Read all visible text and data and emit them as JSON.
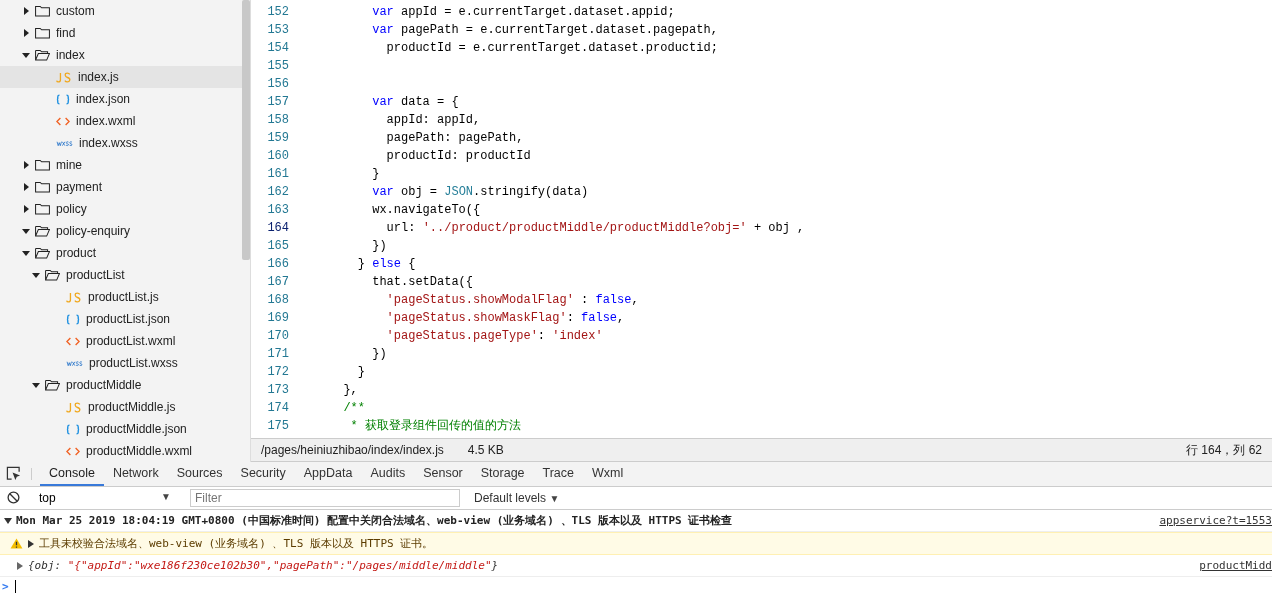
{
  "file_tree": [
    {
      "label": "custom",
      "kind": "folder",
      "expanded": false
    },
    {
      "label": "find",
      "kind": "folder",
      "expanded": false
    },
    {
      "label": "index",
      "kind": "folder",
      "expanded": true,
      "children": [
        {
          "label": "index.js",
          "kind": "js",
          "selected": true
        },
        {
          "label": "index.json",
          "kind": "json",
          "selected": false
        },
        {
          "label": "index.wxml",
          "kind": "wxml",
          "selected": false
        },
        {
          "label": "index.wxss",
          "kind": "wxss",
          "selected": false
        }
      ]
    },
    {
      "label": "mine",
      "kind": "folder",
      "expanded": false
    },
    {
      "label": "payment",
      "kind": "folder",
      "expanded": false
    },
    {
      "label": "policy",
      "kind": "folder",
      "expanded": false
    },
    {
      "label": "policy-enquiry",
      "kind": "folder",
      "expanded": true
    },
    {
      "label": "product",
      "kind": "folder",
      "expanded": true,
      "children": [
        {
          "label": "productList",
          "kind": "folder",
          "expanded": true,
          "children": [
            {
              "label": "productList.js",
              "kind": "js",
              "selected": false
            },
            {
              "label": "productList.json",
              "kind": "json",
              "selected": false
            },
            {
              "label": "productList.wxml",
              "kind": "wxml",
              "selected": false
            },
            {
              "label": "productList.wxss",
              "kind": "wxss",
              "selected": false
            }
          ]
        },
        {
          "label": "productMiddle",
          "kind": "folder",
          "expanded": true,
          "children": [
            {
              "label": "productMiddle.js",
              "kind": "js",
              "selected": false
            },
            {
              "label": "productMiddle.json",
              "kind": "json",
              "selected": false
            },
            {
              "label": "productMiddle.wxml",
              "kind": "wxml",
              "selected": false
            }
          ]
        }
      ]
    }
  ],
  "editor": {
    "lines": [
      {
        "number": "152",
        "current": false,
        "tokens": [
          {
            "kind": "keyword",
            "text": "      var"
          },
          {
            "kind": "plain",
            "text": " appId = e.currentTarget.dataset.appid;"
          }
        ]
      },
      {
        "number": "153",
        "current": false,
        "tokens": [
          {
            "kind": "keyword",
            "text": "      var"
          },
          {
            "kind": "plain",
            "text": " pagePath = e.currentTarget.dataset.pagepath,"
          }
        ]
      },
      {
        "number": "154",
        "current": false,
        "tokens": [
          {
            "kind": "plain",
            "text": "        productId = e.currentTarget.dataset.productid;"
          }
        ]
      },
      {
        "number": "155",
        "current": false
      },
      {
        "number": "156",
        "current": false
      },
      {
        "number": "157",
        "current": false,
        "tokens": [
          {
            "kind": "keyword",
            "text": "      var"
          },
          {
            "kind": "plain",
            "text": " data = {"
          }
        ]
      },
      {
        "number": "158",
        "current": false,
        "tokens": [
          {
            "kind": "plain",
            "text": "        appId: appId,"
          }
        ]
      },
      {
        "number": "159",
        "current": false,
        "tokens": [
          {
            "kind": "plain",
            "text": "        pagePath: pagePath,"
          }
        ]
      },
      {
        "number": "160",
        "current": false,
        "tokens": [
          {
            "kind": "plain",
            "text": "        productId: productId"
          }
        ]
      },
      {
        "number": "161",
        "current": false,
        "tokens": [
          {
            "kind": "plain",
            "text": "      }"
          }
        ]
      },
      {
        "number": "162",
        "current": false,
        "tokens": [
          {
            "kind": "keyword",
            "text": "      var"
          },
          {
            "kind": "plain",
            "text": " obj = "
          },
          {
            "kind": "builtin",
            "text": "JSON"
          },
          {
            "kind": "plain",
            "text": ".stringify(data)"
          }
        ]
      },
      {
        "number": "163",
        "current": false,
        "tokens": [
          {
            "kind": "plain",
            "text": "      wx.navigateTo({"
          }
        ]
      },
      {
        "number": "164",
        "current": true,
        "tokens": [
          {
            "kind": "plain",
            "text": "        url: "
          },
          {
            "kind": "string",
            "text": "'../product/productMiddle/productMiddle?obj='"
          },
          {
            "kind": "plain",
            "text": " + obj ,"
          }
        ]
      },
      {
        "number": "165",
        "current": false,
        "tokens": [
          {
            "kind": "plain",
            "text": "      })"
          }
        ]
      },
      {
        "number": "166",
        "current": false,
        "tokens": [
          {
            "kind": "plain",
            "text": "    } "
          },
          {
            "kind": "keyword",
            "text": "else"
          },
          {
            "kind": "plain",
            "text": " {"
          }
        ]
      },
      {
        "number": "167",
        "current": false,
        "tokens": [
          {
            "kind": "plain",
            "text": "      that.setData({"
          }
        ]
      },
      {
        "number": "168",
        "current": false,
        "tokens": [
          {
            "kind": "string",
            "text": "        'pageStatus.showModalFlag'"
          },
          {
            "kind": "plain",
            "text": " : "
          },
          {
            "kind": "keyword",
            "text": "false"
          },
          {
            "kind": "plain",
            "text": ","
          }
        ]
      },
      {
        "number": "169",
        "current": false,
        "tokens": [
          {
            "kind": "string",
            "text": "        'pageStatus.showMaskFlag'"
          },
          {
            "kind": "plain",
            "text": ": "
          },
          {
            "kind": "keyword",
            "text": "false"
          },
          {
            "kind": "plain",
            "text": ","
          }
        ]
      },
      {
        "number": "170",
        "current": false,
        "tokens": [
          {
            "kind": "string",
            "text": "        'pageStatus.pageType'"
          },
          {
            "kind": "plain",
            "text": ": "
          },
          {
            "kind": "string",
            "text": "'index'"
          }
        ]
      },
      {
        "number": "171",
        "current": false,
        "tokens": [
          {
            "kind": "plain",
            "text": "      })"
          }
        ]
      },
      {
        "number": "172",
        "current": false,
        "tokens": [
          {
            "kind": "plain",
            "text": "    }"
          }
        ]
      },
      {
        "number": "173",
        "current": false,
        "tokens": [
          {
            "kind": "plain",
            "text": "  },"
          }
        ]
      },
      {
        "number": "174",
        "current": false,
        "tokens": [
          {
            "kind": "comment",
            "text": "  /**"
          }
        ]
      },
      {
        "number": "175",
        "current": false,
        "tokens": [
          {
            "kind": "comment",
            "text": "   * 获取登录组件回传的值的方法"
          }
        ]
      }
    ]
  },
  "status_bar": {
    "path": "/pages/heiniuzhibao/index/index.js",
    "size": "4.5 KB",
    "cursor": "行 164，列 62"
  },
  "devtools": {
    "tabs": [
      {
        "label": "Console",
        "selected": true
      },
      {
        "label": "Network",
        "selected": false
      },
      {
        "label": "Sources",
        "selected": false
      },
      {
        "label": "Security",
        "selected": false
      },
      {
        "label": "AppData",
        "selected": false
      },
      {
        "label": "Audits",
        "selected": false
      },
      {
        "label": "Sensor",
        "selected": false
      },
      {
        "label": "Storage",
        "selected": false
      },
      {
        "label": "Trace",
        "selected": false
      },
      {
        "label": "Wxml",
        "selected": false
      }
    ],
    "context": "top",
    "context_caret": "▼",
    "filter": {
      "placeholder": "Filter"
    },
    "levels": "Default levels",
    "levels_caret": "▼",
    "messages": [
      {
        "kind": "group",
        "expanded": true,
        "text": "Mon Mar 25 2019 18:04:19 GMT+0800 (中国标准时间) 配置中关闭合法域名、web-view (业务域名) 、TLS 版本以及 HTTPS 证书检查",
        "source": "appservice?t=1553"
      },
      {
        "kind": "warning",
        "expanded": false,
        "text": "工具未校验合法域名、web-view (业务域名) 、TLS 版本以及 HTTPS 证书。"
      },
      {
        "kind": "object",
        "expanded": false,
        "prefix": "{obj: ",
        "value": "\"{\"appId\":\"wxe186f230ce102b30\",\"pagePath\":\"/pages/middle/middle\"",
        "suffix": "}",
        "source": "productMidd"
      }
    ],
    "prompt": ">"
  }
}
